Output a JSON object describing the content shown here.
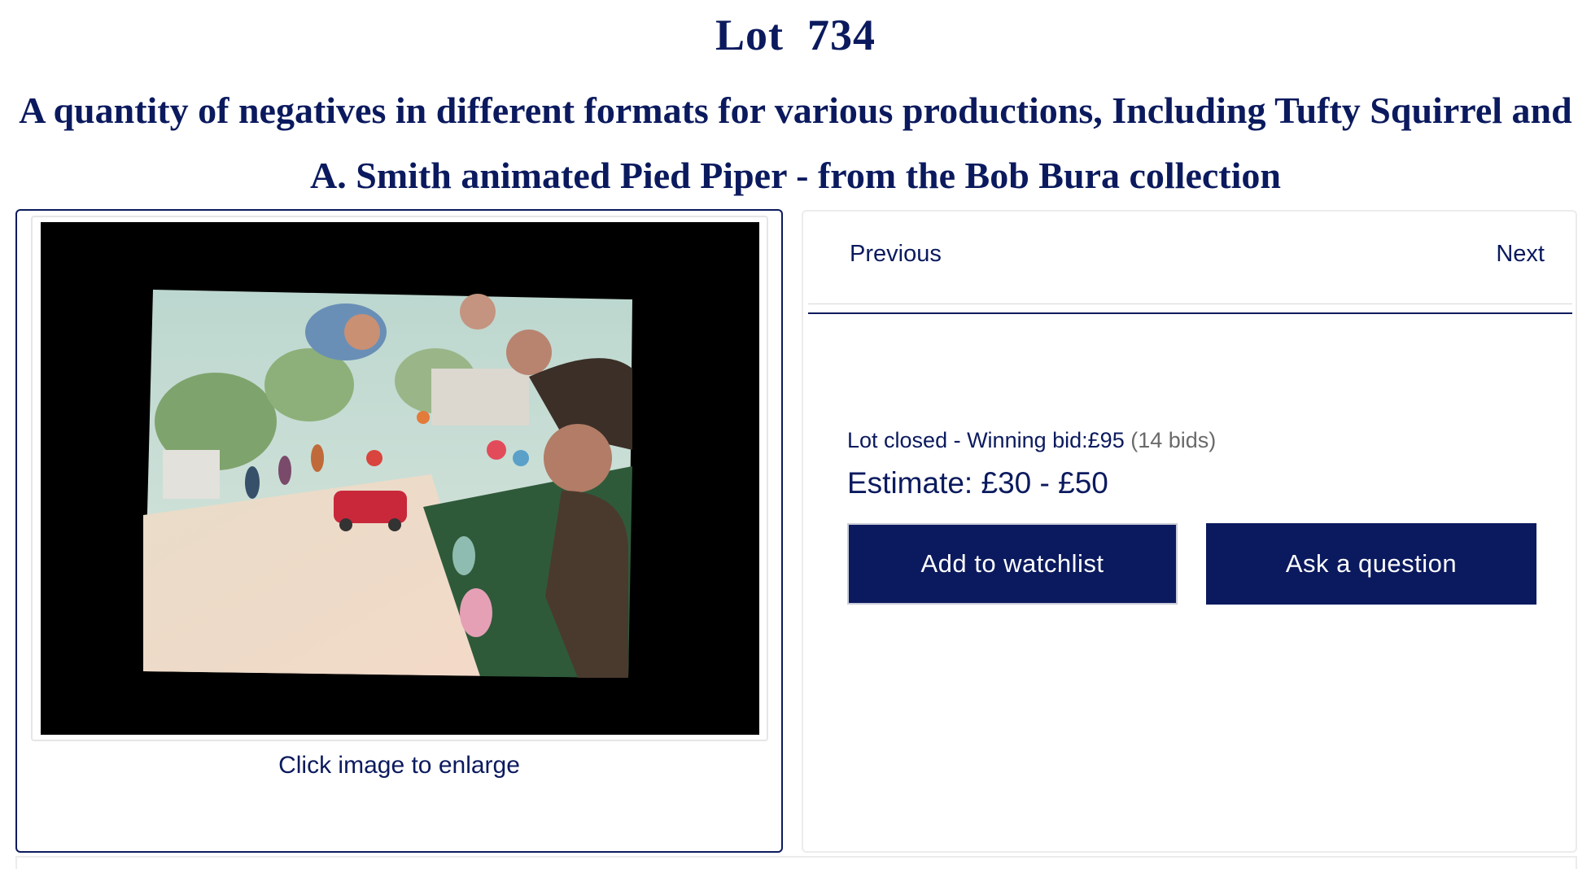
{
  "lot": {
    "label": "Lot",
    "number": "734",
    "title": "A quantity of negatives in different formats for various productions, Including Tufty Squirrel and A. Smith animated Pied Piper - from the Bob Bura collection"
  },
  "gallery": {
    "caption": "Click image to enlarge"
  },
  "nav": {
    "previous": "Previous",
    "next": "Next"
  },
  "status": {
    "closed_label": "Lot closed - Winning bid:",
    "winning_bid": "£95",
    "bid_count": "(14 bids)"
  },
  "estimate": {
    "label": "Estimate:",
    "range": "£30 - £50"
  },
  "actions": {
    "watchlist": "Add to watchlist",
    "ask": "Ask a question"
  },
  "colors": {
    "brand_navy": "#0b1a5e",
    "photo_background": "#000000"
  }
}
